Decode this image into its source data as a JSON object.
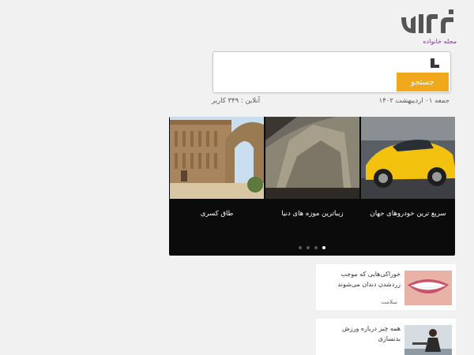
{
  "logo": {
    "tagline": "مجله خانواده",
    "brand_color": "#555555",
    "tagline_color": "#7a3a8c"
  },
  "search": {
    "value": "",
    "placeholder": "",
    "button_label": "جستجو",
    "button_color": "#f2a81d"
  },
  "status": {
    "date": "جمعه ۰۱ اردیبهشت ۱۴۰۲",
    "online": "آنلاین : ۳۴۹ کاربر"
  },
  "slider": {
    "slides": [
      {
        "caption": "سریع ترین خودروهای جهان",
        "image": "yellow-sports-car"
      },
      {
        "caption": "زیباترین موزه های دنیا",
        "image": "museum-stairs"
      },
      {
        "caption": "طاق کسری",
        "image": "taq-kasra-arch"
      }
    ],
    "dot_count": 4,
    "active_dot": 1
  },
  "articles": [
    {
      "title": "خوراکی‌هایی که موجب زردشدن دندان می‌شوند",
      "category": "سلامت",
      "image": "smile-teeth"
    },
    {
      "title": "همه چیز درباره ورزش بدنسازی",
      "category": "",
      "image": "fitness-woman"
    }
  ]
}
